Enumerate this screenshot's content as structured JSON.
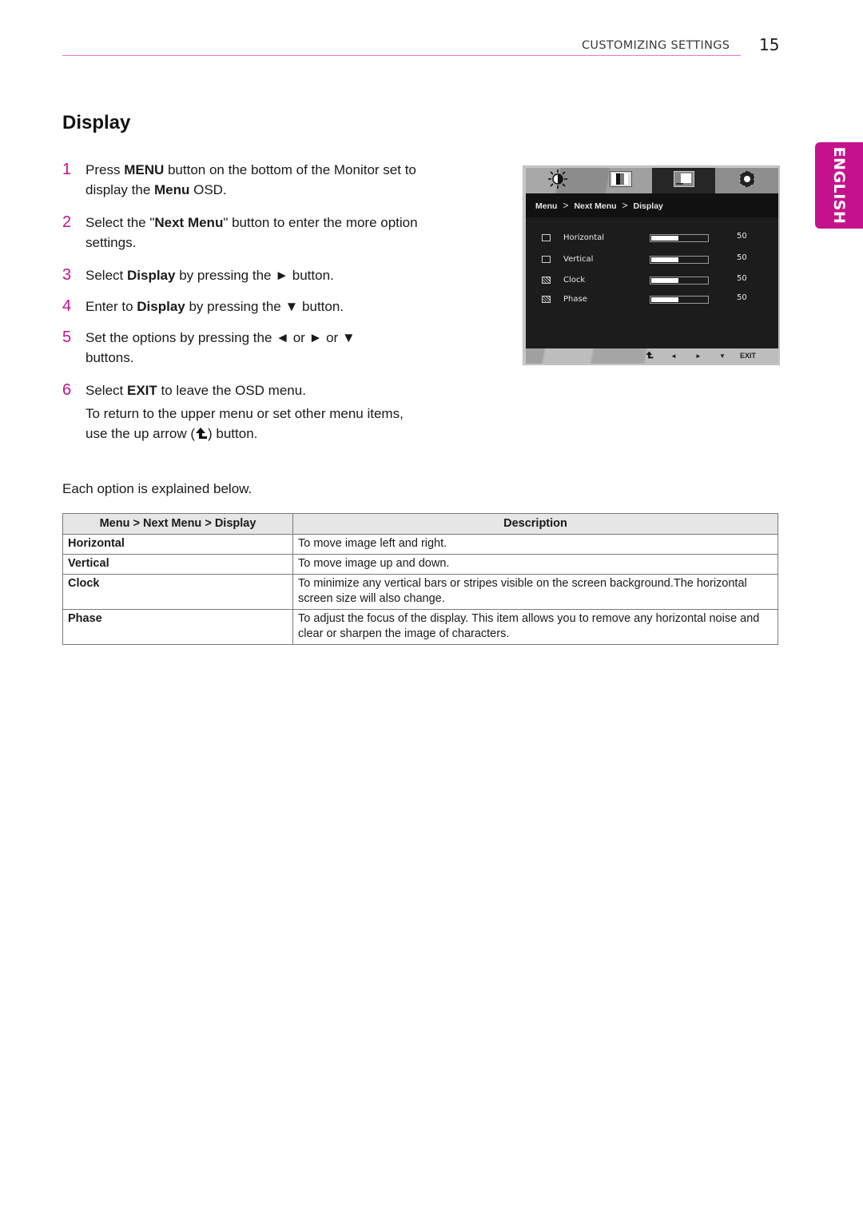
{
  "header": {
    "section_title": "CUSTOMIZING SETTINGS",
    "page_number": "15",
    "accent_color": "#c5128c"
  },
  "language_tab": {
    "label": "ENGLISH"
  },
  "title": "Display",
  "steps": [
    {
      "num": "1",
      "parts": [
        {
          "t": "Press ",
          "b": false
        },
        {
          "t": "MENU",
          "b": true
        },
        {
          "t": " button on the bottom of the Monitor set to display the ",
          "b": false
        },
        {
          "t": "Menu",
          "b": true
        },
        {
          "t": " OSD.",
          "b": false
        }
      ]
    },
    {
      "num": "2",
      "parts": [
        {
          "t": "Select the \"",
          "b": false
        },
        {
          "t": "Next Menu",
          "b": true
        },
        {
          "t": "\" button to enter the more option settings.",
          "b": false
        }
      ]
    },
    {
      "num": "3",
      "parts": [
        {
          "t": "Select ",
          "b": false
        },
        {
          "t": "Display",
          "b": true
        },
        {
          "t": " by pressing the ► button.",
          "b": false
        }
      ]
    },
    {
      "num": "4",
      "parts": [
        {
          "t": "Enter to ",
          "b": false
        },
        {
          "t": "Display",
          "b": true
        },
        {
          "t": " by pressing the ▼ button.",
          "b": false
        }
      ]
    },
    {
      "num": "5",
      "parts": [
        {
          "t": "Set the options by pressing the ◄ or ► or ▼ buttons.",
          "b": false
        }
      ]
    },
    {
      "num": "6",
      "parts": [
        {
          "t": "Select ",
          "b": false
        },
        {
          "t": "EXIT",
          "b": true
        },
        {
          "t": " to leave the OSD menu.",
          "b": false
        }
      ]
    }
  ],
  "note": {
    "line1": "To return to the upper menu or set other menu items,",
    "line2_pre": "use the up arrow (",
    "line2_icon": "up-arrow-icon",
    "line2_post": ") button."
  },
  "intro": "Each option is explained below.",
  "osd": {
    "tabs": [
      {
        "icon": "brightness-icon"
      },
      {
        "icon": "color-bars-icon"
      },
      {
        "icon": "display-icon",
        "active": true
      },
      {
        "icon": "gear-icon"
      }
    ],
    "breadcrumb": [
      "Menu",
      "Next Menu",
      "Display"
    ],
    "breadcrumb_sep": ">",
    "items": [
      {
        "label": "Horizontal",
        "value": "50",
        "level": 0.5
      },
      {
        "label": "Vertical",
        "value": "50",
        "level": 0.5
      },
      {
        "label": "Clock",
        "value": "50",
        "level": 0.5
      },
      {
        "label": "Phase",
        "value": "50",
        "level": 0.5
      }
    ],
    "footer": {
      "up": "⮤",
      "left": "◄",
      "right": "►",
      "down": "▼",
      "exit": "EXIT"
    }
  },
  "table": {
    "headers": [
      "Menu > Next Menu > Display",
      "Description"
    ],
    "rows": [
      {
        "name": "Horizontal",
        "desc": "To move image left and right."
      },
      {
        "name": "Vertical",
        "desc": "To move image up and down."
      },
      {
        "name": "Clock",
        "desc": "To minimize any vertical bars or stripes visible on the screen background.The horizontal screen size will also change."
      },
      {
        "name": "Phase",
        "desc": "To adjust the focus of the display. This item allows you to remove any horizontal noise and clear or sharpen the image of characters."
      }
    ]
  }
}
